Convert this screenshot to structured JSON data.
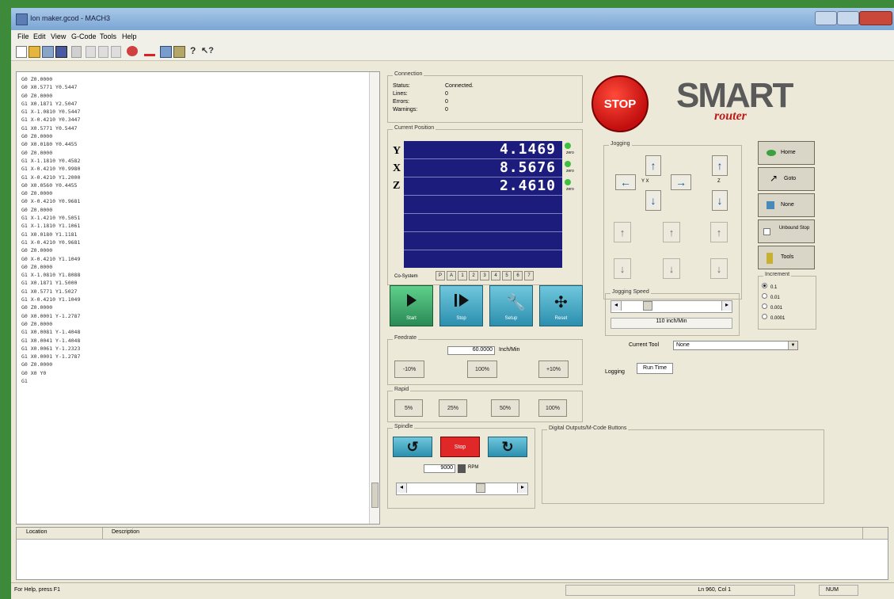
{
  "window": {
    "title": "Ion maker.gcod - MACH3"
  },
  "menu": [
    "File",
    "Edit",
    "View",
    "G-Code",
    "Tools",
    "Help"
  ],
  "gcode_lines": [
    "G0 Z0.0000",
    "G0 X0.5771 Y0.5447",
    "G0 Z0.0000",
    "G1 X0.1871 Y2.5047",
    "G1 X-1.0810 Y0.5447",
    "G1 X-0.4210 Y0.3447",
    "G1 X0.5771 Y0.5447",
    "G0 Z0.0000",
    "G0 X0.0180 Y0.4455",
    "G0 Z0.0000",
    "G1 X-1.1810 Y0.4582",
    "G1 X-0.4210 Y0.9980",
    "G1 X-0.4210 Y1.2000",
    "G0 X0.0560 Y0.4455",
    "G0 Z0.0000",
    "G0 X-0.4210 Y0.9681",
    "G0 Z0.0000",
    "G1 X-1.4210 Y0.5051",
    "G1 X-1.1810 Y1.1061",
    "G1 X0.0180 Y1.1181",
    "G1 X-0.4210 Y0.9681",
    "G0 Z0.0000",
    "G0 X-0.4210 Y1.1049",
    "G0 Z0.0000",
    "G1 X-1.0810 Y1.8088",
    "G1 X0.1871 Y1.5000",
    "G1 X0.5771 Y1.5027",
    "G1 X-0.4210 Y1.1049",
    "G0 Z0.0000",
    "G0 X0.0001 Y-1.2787",
    "G0 Z0.0000",
    "G1 X0.0081 Y-1.4048",
    "G1 X0.0041 Y-1.4048",
    "G1 X0.0061 Y-1.2323",
    "G1 X0.0001 Y-1.2787",
    "G0 Z0.0000",
    "G0 X0 Y0",
    "G1"
  ],
  "connection": {
    "label": "Connection",
    "status_label": "Status:",
    "status_value": "Connected.",
    "lines_label": "Lines:",
    "lines_value": "0",
    "errors_label": "Errors:",
    "errors_value": "0",
    "warnings_label": "Warnings:",
    "warnings_value": "0"
  },
  "position": {
    "label": "Current Position",
    "axes": [
      {
        "name": "Y",
        "value": "4.1469"
      },
      {
        "name": "X",
        "value": "8.5676"
      },
      {
        "name": "Z",
        "value": "2.4610"
      }
    ],
    "zero_label": "zero",
    "cs_label": "Co-System",
    "cs_buttons": [
      "P",
      "A",
      "1",
      "2",
      "3",
      "4",
      "5",
      "6",
      "7"
    ]
  },
  "run": {
    "start": "Start",
    "stop": "Stop",
    "setup": "Setup",
    "reset": "Reset"
  },
  "stop_button": "STOP",
  "logo": {
    "main": "SMART",
    "sub": "router"
  },
  "jogging": {
    "label": "Jogging",
    "xy_label": "Y X",
    "z_label": "Z",
    "speed_label": "Jogging Speed",
    "speed_value": "110 inch/Min",
    "tab1": "Logging",
    "tab2": "Run Time"
  },
  "side_buttons": {
    "home": "Home",
    "goto": "Goto",
    "none": "None",
    "unbound": "Unbound Stop",
    "tools": "Tools"
  },
  "increment": {
    "label": "Increment",
    "options": [
      "0.1",
      "0.01",
      "0.001",
      "0.0001"
    ],
    "selected": 0
  },
  "current_tool": {
    "label": "Current Tool",
    "value": "None"
  },
  "feedrate": {
    "label": "Feedrate",
    "value": "60.0000",
    "units": "Inch/Min",
    "buttons": [
      "-10%",
      "100%",
      "+10%"
    ]
  },
  "rapid": {
    "label": "Rapid",
    "buttons": [
      "5%",
      "25%",
      "50%",
      "100%"
    ]
  },
  "spindle": {
    "label": "Spindle",
    "stop": "Stop",
    "rpm_value": "9000",
    "rpm_label": "RPM"
  },
  "digital": {
    "label": "Digital Outputs/M-Code Buttons"
  },
  "table": {
    "col1": "Location",
    "col2": "Description"
  },
  "statusbar": {
    "help": "For Help, press F1",
    "pos": "Ln 960, Col 1",
    "mode": "NUM"
  }
}
